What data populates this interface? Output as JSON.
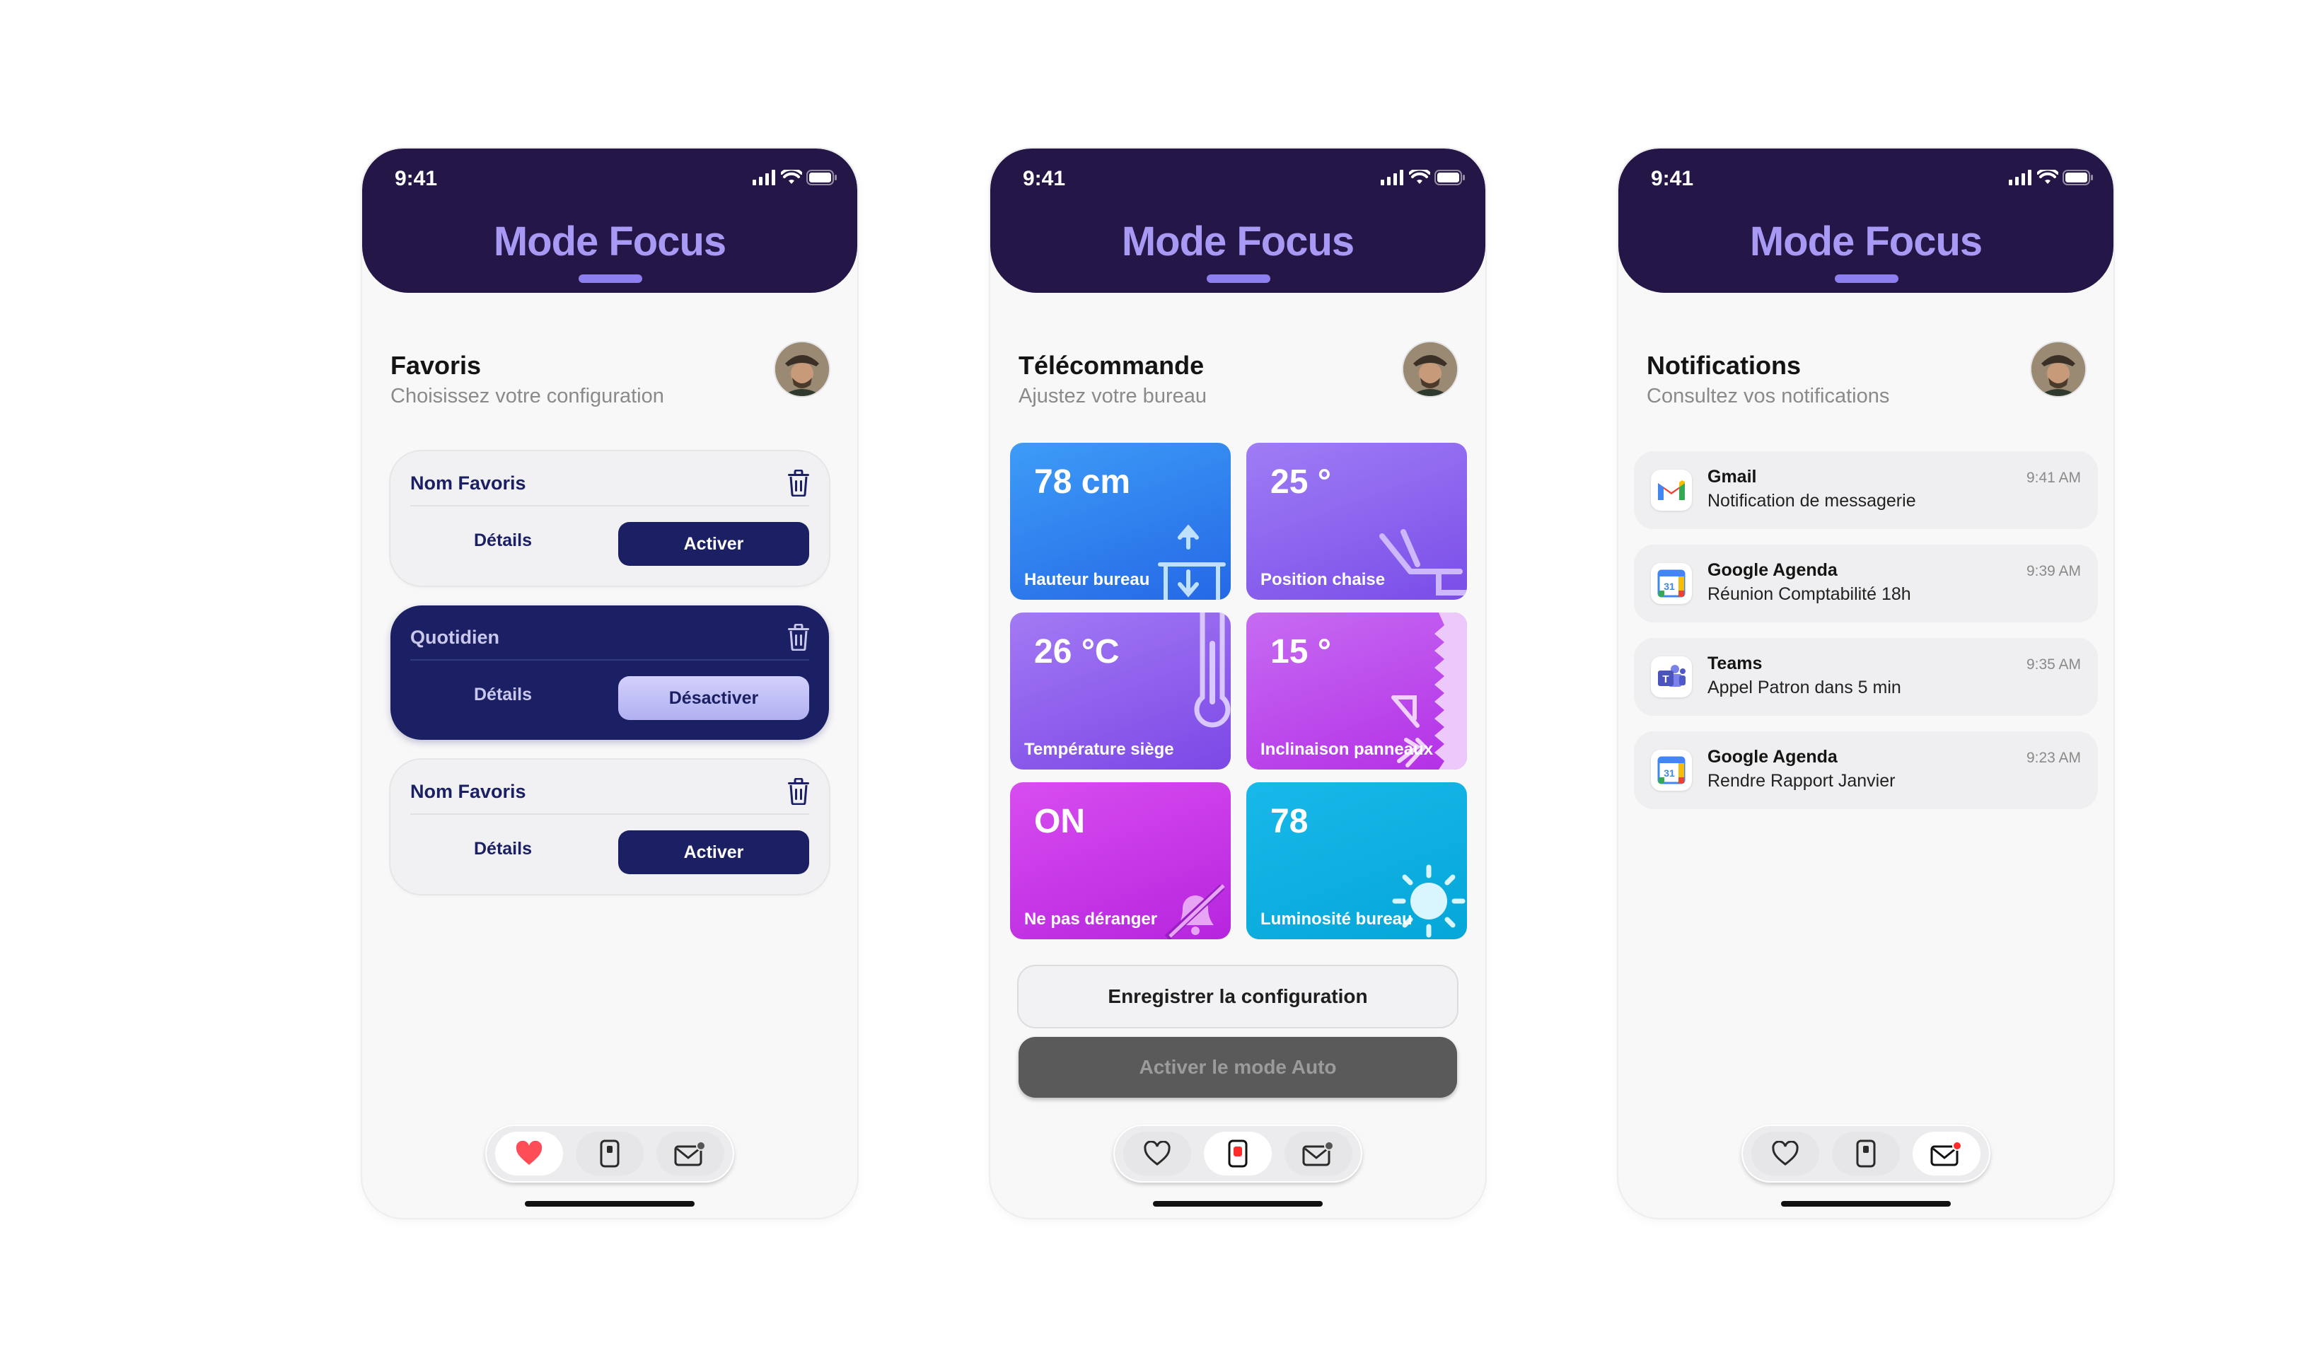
{
  "status": {
    "time": "9:41"
  },
  "app_title": "Mode Focus",
  "favoris": {
    "title": "Favoris",
    "subtitle": "Choisissez votre configuration",
    "cards": [
      {
        "name": "Nom Favoris",
        "details": "Détails",
        "action": "Activer"
      },
      {
        "name": "Quotidien",
        "details": "Détails",
        "action": "Désactiver"
      },
      {
        "name": "Nom Favoris",
        "details": "Détails",
        "action": "Activer"
      }
    ]
  },
  "remote": {
    "title": "Télécommande",
    "subtitle": "Ajustez votre bureau",
    "tiles": [
      {
        "value": "78 cm",
        "label": "Hauteur bureau",
        "icon": "desk-height-icon"
      },
      {
        "value": "25 °",
        "label": "Position chaise",
        "icon": "chair-icon"
      },
      {
        "value": "26 °C",
        "label": "Température siège",
        "icon": "thermometer-icon"
      },
      {
        "value": "15 °",
        "label": "Inclinaison panneaux",
        "icon": "panel-tilt-icon"
      },
      {
        "value": "ON",
        "label": "Ne pas déranger",
        "icon": "bell-off-icon"
      },
      {
        "value": "78",
        "label": "Luminosité bureau",
        "icon": "sun-icon"
      }
    ],
    "save_label": "Enregistrer la configuration",
    "auto_label": "Activer le mode Auto"
  },
  "notifications": {
    "title": "Notifications",
    "subtitle": "Consultez vos notifications",
    "items": [
      {
        "app": "Gmail",
        "message": "Notification de messagerie",
        "time": "9:41 AM",
        "icon": "gmail-icon"
      },
      {
        "app": "Google Agenda",
        "message": "Réunion Comptabilité 18h",
        "time": "9:39 AM",
        "icon": "google-calendar-icon"
      },
      {
        "app": "Teams",
        "message": "Appel Patron dans 5 min",
        "time": "9:35 AM",
        "icon": "teams-icon"
      },
      {
        "app": "Google Agenda",
        "message": "Rendre Rapport Janvier",
        "time": "9:23 AM",
        "icon": "google-calendar-icon"
      }
    ]
  },
  "colors": {
    "header": "#241646",
    "title": "#a89af4",
    "navy": "#1b2064",
    "favorite_active": "#ff4d57",
    "notification_badge": "#ff2b2b"
  }
}
